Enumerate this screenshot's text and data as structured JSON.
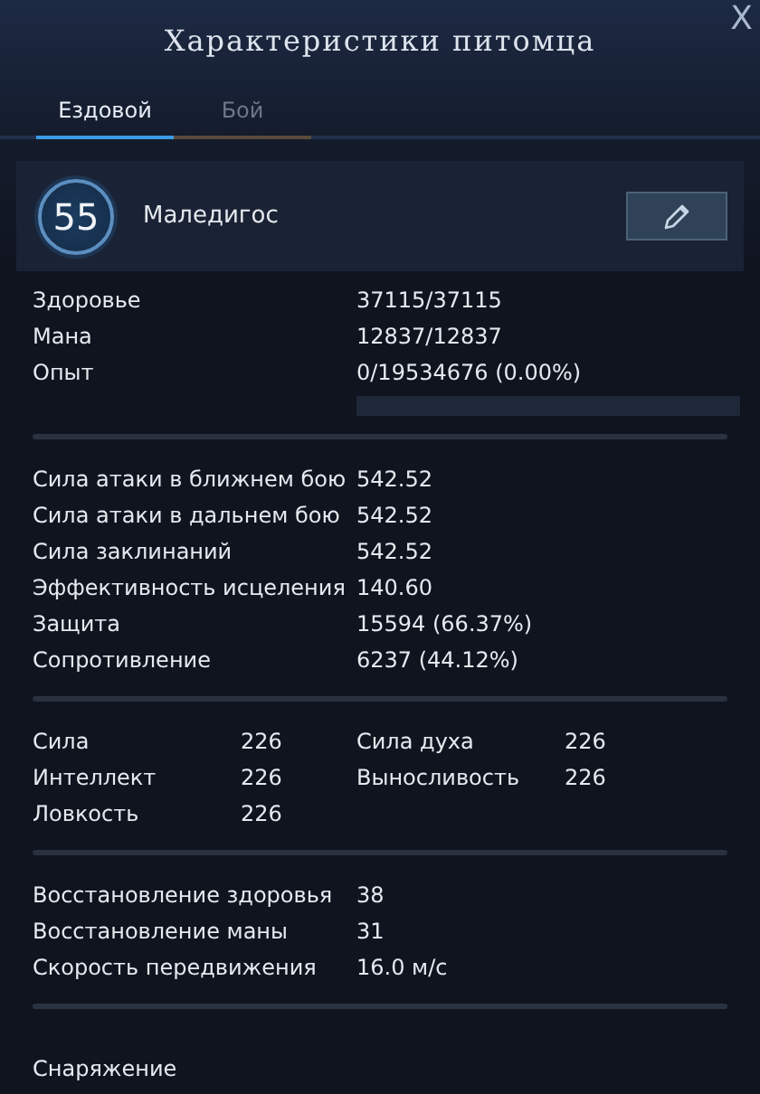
{
  "window": {
    "title": "Характеристики питомца",
    "close": "X"
  },
  "tabs": [
    {
      "label": "Ездовой",
      "selected": true
    },
    {
      "label": "Бой",
      "selected": false
    }
  ],
  "pet": {
    "level": "55",
    "name": "Маледигос"
  },
  "basic": [
    {
      "label": "Здоровье",
      "value": "37115/37115"
    },
    {
      "label": "Мана",
      "value": "12837/12837"
    },
    {
      "label": "Опыт",
      "value": "0/19534676 (0.00%)"
    }
  ],
  "experience_bar": {
    "level": 0
  },
  "combat": [
    {
      "label": "Сила атаки в ближнем бою",
      "value": "542.52"
    },
    {
      "label": "Сила атаки в дальнем бою",
      "value": "542.52"
    },
    {
      "label": "Сила заклинаний",
      "value": "542.52"
    },
    {
      "label": "Эффективность исцеления",
      "value": "140.60"
    },
    {
      "label": "Защита",
      "value": "15594 (66.37%)"
    },
    {
      "label": "Сопротивление",
      "value": "6237 (44.12%)"
    }
  ],
  "attributes": [
    {
      "label": "Сила",
      "value": "226"
    },
    {
      "label": "Сила духа",
      "value": "226"
    },
    {
      "label": "Интеллект",
      "value": "226"
    },
    {
      "label": "Выносливость",
      "value": "226"
    },
    {
      "label": "Ловкость",
      "value": "226"
    }
  ],
  "regen": [
    {
      "label": "Восстановление здоровья",
      "value": "38"
    },
    {
      "label": "Восстановление маны",
      "value": "31"
    },
    {
      "label": "Скорость передвижения",
      "value": "16.0 м/с"
    }
  ],
  "equipment": {
    "label": "Снаряжение"
  }
}
